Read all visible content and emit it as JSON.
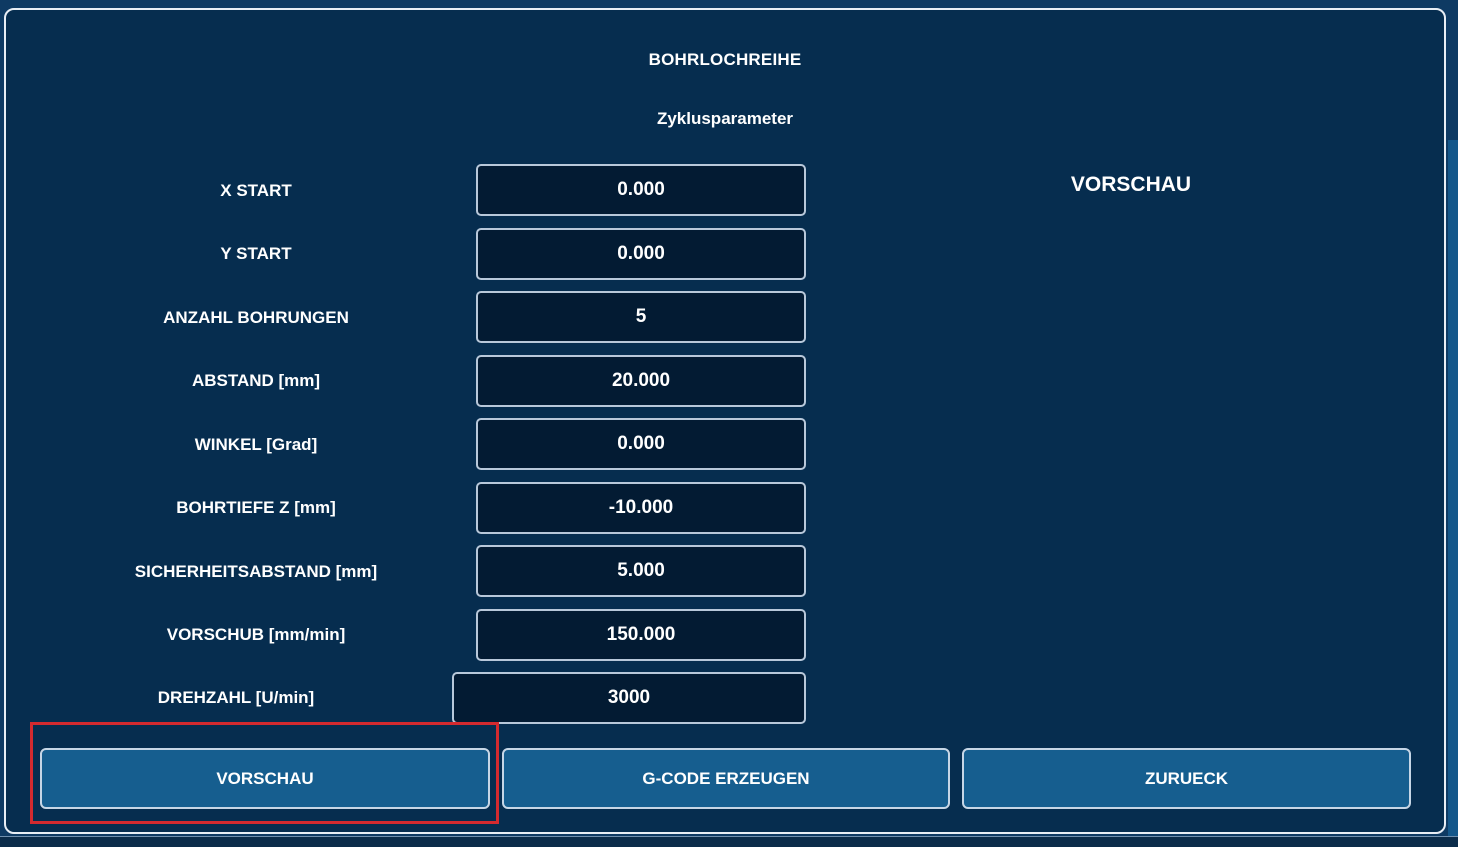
{
  "dialog": {
    "title": "BOHRLOCHREIHE",
    "subtitle": "Zyklusparameter",
    "preview_label": "VORSCHAU"
  },
  "params": [
    {
      "label": "X START",
      "value": "0.000"
    },
    {
      "label": "Y START",
      "value": "0.000"
    },
    {
      "label": "ANZAHL BOHRUNGEN",
      "value": "5"
    },
    {
      "label": "ABSTAND [mm]",
      "value": "20.000"
    },
    {
      "label": "WINKEL [Grad]",
      "value": "0.000"
    },
    {
      "label": "BOHRTIEFE Z [mm]",
      "value": "-10.000"
    },
    {
      "label": "SICHERHEITSABSTAND [mm]",
      "value": "5.000"
    },
    {
      "label": "VORSCHUB [mm/min]",
      "value": "150.000"
    },
    {
      "label": "DREHZAHL [U/min]",
      "value": "3000"
    }
  ],
  "buttons": {
    "preview": "VORSCHAU",
    "generate": "G-CODE ERZEUGEN",
    "back": "ZURUECK"
  },
  "colors": {
    "dialog_bg": "#062d4f",
    "input_bg": "#031b33",
    "button_bg": "#165e8f",
    "highlight": "#d32a2f"
  }
}
